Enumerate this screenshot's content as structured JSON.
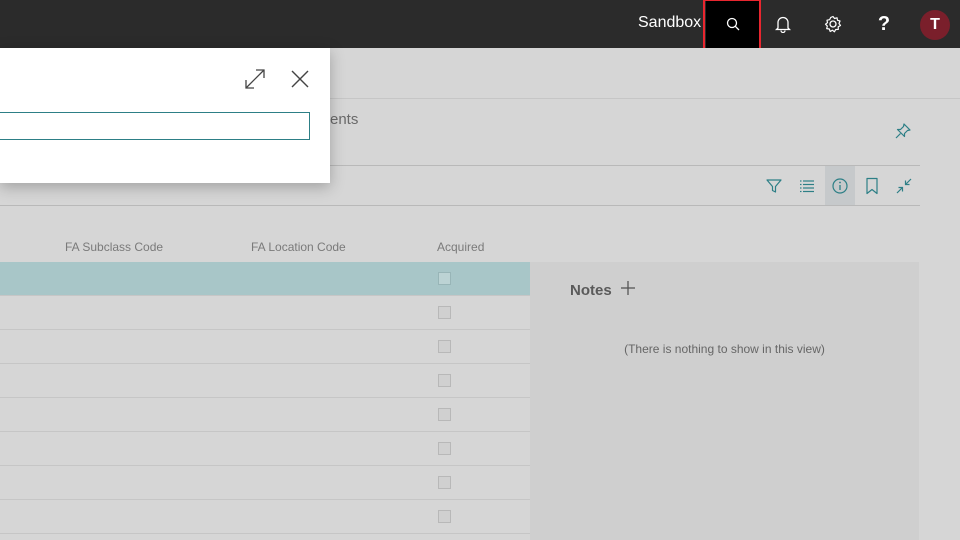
{
  "topbar": {
    "environment": "Sandbox",
    "avatar_initial": "T",
    "help_label": "?"
  },
  "page": {
    "tab_fragment": "ents"
  },
  "columns": [
    "FA Subclass Code",
    "FA Location Code",
    "Acquired"
  ],
  "rows": 8,
  "factbox": {
    "notes_title": "Notes",
    "empty_message": "(There is nothing to show in this view)"
  },
  "dialog": {
    "search_value": ""
  },
  "colors": {
    "accent": "#2d7f86",
    "highlight": "#e8262f",
    "avatar": "#7a1f2b",
    "selected_row": "#a8c6c8"
  },
  "icons": [
    "search-icon",
    "bell-icon",
    "gear-icon",
    "help-icon",
    "pin-icon",
    "filter-icon",
    "list-icon",
    "info-icon",
    "bookmark-icon",
    "collapse-icon",
    "expand-icon",
    "close-icon",
    "plus-icon"
  ]
}
